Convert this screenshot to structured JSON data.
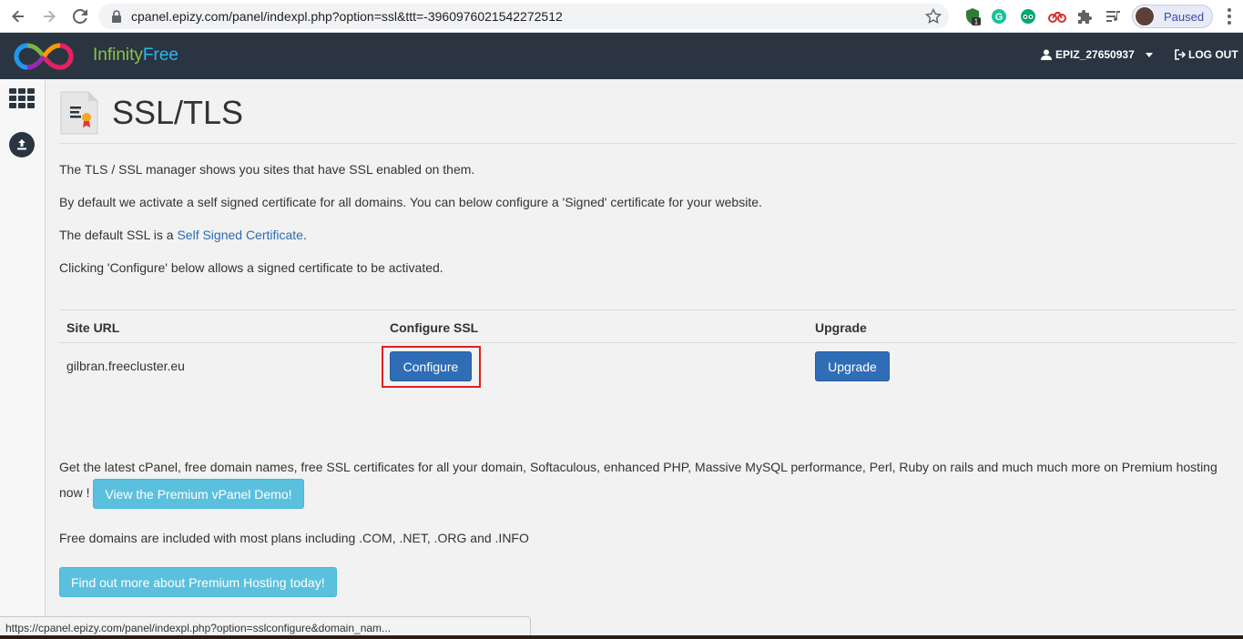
{
  "browser": {
    "url": "cpanel.epizy.com/panel/indexpl.php?option=ssl&ttt=-3960976021542272512",
    "profile_label": "Paused",
    "extension_badge": "1",
    "status_url": "https://cpanel.epizy.com/panel/indexpl.php?option=sslconfigure&domain_nam..."
  },
  "header": {
    "brand_part1": "Infinity",
    "brand_part2": "Free",
    "username": "EPIZ_27650937",
    "logout_label": "LOG OUT"
  },
  "page": {
    "title": "SSL/TLS",
    "p1": "The TLS / SSL manager shows you sites that have SSL enabled on them.",
    "p2": "By default we activate a self signed certificate for all domains. You can below configure a 'Signed' certificate for your website.",
    "p3_prefix": "The default SSL is a ",
    "p3_link": "Self Signed Certificate",
    "p3_suffix": ".",
    "p4": "Clicking 'Configure' below allows a signed certificate to be activated."
  },
  "table": {
    "columns": [
      "Site URL",
      "Configure SSL",
      "Upgrade"
    ],
    "rows": [
      {
        "site_url": "gilbran.freecluster.eu",
        "configure_label": "Configure",
        "upgrade_label": "Upgrade"
      }
    ]
  },
  "promo": {
    "text": "Get the latest cPanel, free domain names, free SSL certificates for all your domain, Softaculous, enhanced PHP, Massive MySQL performance, Perl, Ruby on rails and much much more on Premium hosting now ! ",
    "demo_button": "View the Premium vPanel Demo!",
    "domains_text": "Free domains are included with most plans including .COM, .NET, .ORG and .INFO",
    "cta_button": "Find out more about Premium Hosting today!"
  },
  "colors": {
    "header_bg": "#2a3541",
    "primary_button": "#2f6db7",
    "info_button": "#5bc0de",
    "highlight": "#e02020"
  }
}
